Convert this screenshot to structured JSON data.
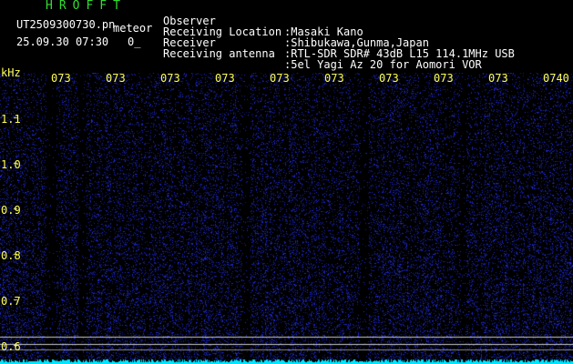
{
  "header": {
    "app_title": "HROFFT",
    "file_name": "UT2509300730.pn",
    "detect_label": "meteor",
    "date_time": "25.09.30 07:30",
    "count": "0_"
  },
  "station_info": [
    {
      "label": "Observer",
      "value": ":Masaki Kano"
    },
    {
      "label": "Receiving Location",
      "value": ":Shibukawa,Gunma,Japan"
    },
    {
      "label": "Receiver",
      "value": ":RTL-SDR SDR# 43dB L15 114.1MHz USB"
    },
    {
      "label": "Receiving antenna",
      "value": ":5el Yagi Az 20 for Aomori VOR"
    }
  ],
  "axis": {
    "unit": "kHz",
    "freq_ticks": [
      "1.1",
      "1.0",
      "0.9",
      "0.8",
      "0.7",
      "0.6"
    ],
    "time_ticks": [
      "073",
      "073",
      "073",
      "073",
      "073",
      "073",
      "073",
      "073",
      "073",
      "0740"
    ]
  },
  "colors": {
    "background": "#000000",
    "noise": "#1a2cc8",
    "label": "#ffff55",
    "title": "#33dd33",
    "trace": "#00e5ff"
  }
}
